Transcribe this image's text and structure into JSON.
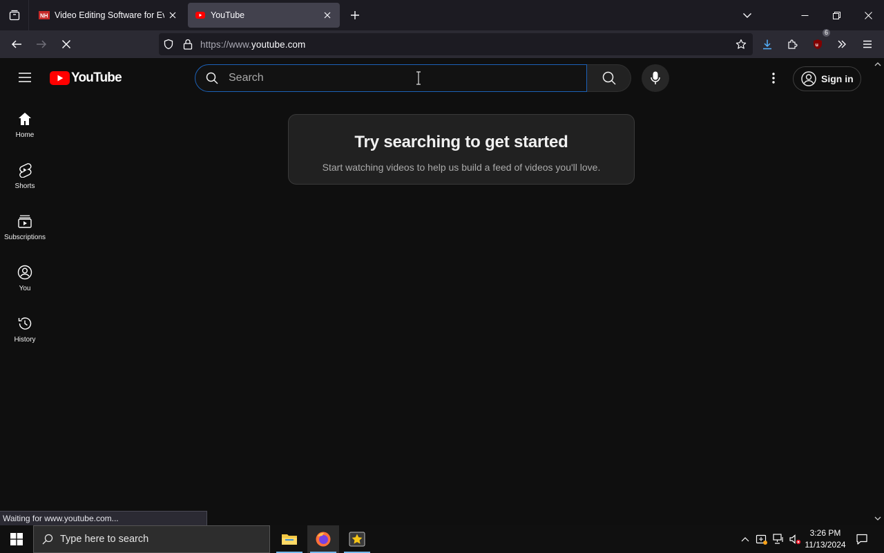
{
  "browser": {
    "tabs": [
      {
        "title": "Video Editing Software for Every",
        "active": false
      },
      {
        "title": "YouTube",
        "active": true
      }
    ],
    "url_protocol": "https://www.",
    "url_domain": "youtube.com",
    "extension_badge": "6",
    "status_text": "Waiting for www.youtube.com..."
  },
  "youtube": {
    "logo_text": "YouTube",
    "search_placeholder": "Search",
    "sign_in_label": "Sign in",
    "guide": [
      {
        "label": "Home",
        "icon": "home-icon"
      },
      {
        "label": "Shorts",
        "icon": "shorts-icon"
      },
      {
        "label": "Subscriptions",
        "icon": "subscriptions-icon"
      },
      {
        "label": "You",
        "icon": "you-icon"
      },
      {
        "label": "History",
        "icon": "history-icon"
      }
    ],
    "prompt_title": "Try searching to get started",
    "prompt_body": "Start watching videos to help us build a feed of videos you'll love."
  },
  "taskbar": {
    "search_placeholder": "Type here to search",
    "time": "3:26 PM",
    "date": "11/13/2024"
  },
  "colors": {
    "youtube_red": "#ff0000",
    "link_blue": "#3ea6ff",
    "search_focus": "#1c62b9",
    "page_background": "#0f0f0f"
  }
}
